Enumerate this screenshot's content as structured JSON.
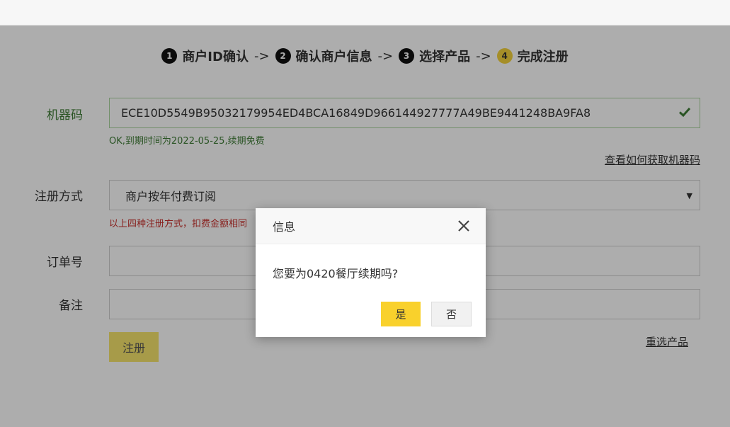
{
  "steps": [
    {
      "num": "1",
      "label": "商户ID确认"
    },
    {
      "num": "2",
      "label": "确认商户信息"
    },
    {
      "num": "3",
      "label": "选择产品"
    },
    {
      "num": "4",
      "label": "完成注册"
    }
  ],
  "step_arrow": "->",
  "form": {
    "machine_code_label": "机器码",
    "machine_code_value": "ECE10D5549B95032179954ED4BCA16849D966144927777A49BE9441248BA9FA8",
    "machine_code_status": "OK,到期时间为2022-05-25,续期免费",
    "how_to_get_link": "查看如何获取机器码",
    "reg_method_label": "注册方式",
    "reg_method_value": "商户按年付费订阅",
    "reg_method_hint": "以上四种注册方式，扣费金额相同",
    "order_label": "订单号",
    "order_value": "",
    "remark_label": "备注",
    "remark_value": "",
    "register_button": "注册",
    "reselect_link": "重选产品"
  },
  "dialog": {
    "title": "信息",
    "message": "您要为0420餐厅续期吗?",
    "yes_label": "是",
    "no_label": "否"
  },
  "colors": {
    "accent_yellow": "#f9d12c",
    "ok_green": "#3e7d36",
    "warn_red": "#c9302c"
  }
}
